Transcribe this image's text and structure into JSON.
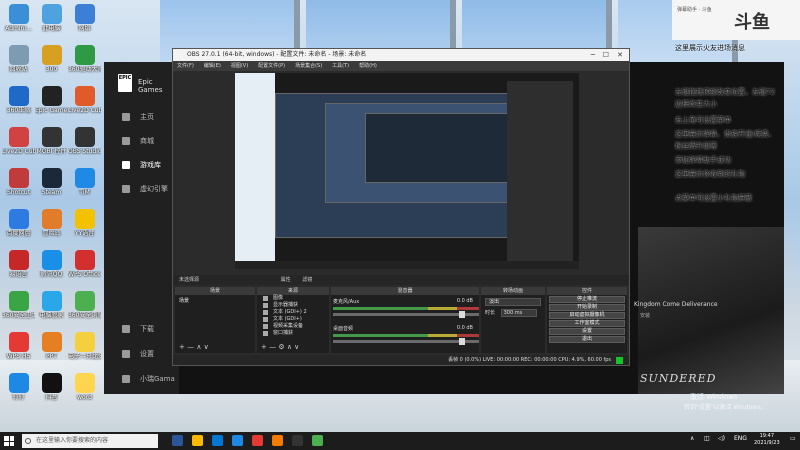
{
  "desktop_icons": [
    {
      "label": "Admini...",
      "color": "#3b8fd6"
    },
    {
      "label": "此电脑",
      "color": "#4ea2e0"
    },
    {
      "label": "网络",
      "color": "#3b7fd6"
    },
    {
      "label": "回收站",
      "color": "#7d9bb3"
    },
    {
      "label": "300",
      "color": "#d8a020"
    },
    {
      "label": "360驱动大师",
      "color": "#2e9b44"
    },
    {
      "label": "360压缩",
      "color": "#1d6bc7"
    },
    {
      "label": "Epic Games Launcher",
      "color": "#222222"
    },
    {
      "label": "Live2D Cubism",
      "color": "#e05a2a"
    },
    {
      "label": "Live2D Cubism",
      "color": "#d14343"
    },
    {
      "label": "MOBI 控件",
      "color": "#333333"
    },
    {
      "label": "OBS Studio",
      "color": "#333333"
    },
    {
      "label": "Shotcut",
      "color": "#c23b3b"
    },
    {
      "label": "Steam",
      "color": "#1b2838"
    },
    {
      "label": "TIM",
      "color": "#1e8ae6"
    },
    {
      "label": "百度网盘",
      "color": "#2d7be0"
    },
    {
      "label": "冒险岛",
      "color": "#e07c2a"
    },
    {
      "label": "YY语音",
      "color": "#f2c200"
    },
    {
      "label": "易语言",
      "color": "#c62828"
    },
    {
      "label": "腾讯QQ",
      "color": "#1a8fe8"
    },
    {
      "label": "WPS Office",
      "color": "#d32f2f"
    },
    {
      "label": "360安全卫士",
      "color": "#3aa545"
    },
    {
      "label": "电脑管家",
      "color": "#2aa7e8"
    },
    {
      "label": "360安全浏览器",
      "color": "#4caf50"
    },
    {
      "label": "WPS H5",
      "color": "#e53935"
    },
    {
      "label": "PPT",
      "color": "#e67e22"
    },
    {
      "label": "电子—只比资料",
      "color": "#f4d03f"
    },
    {
      "label": "钉钉",
      "color": "#1e88e5"
    },
    {
      "label": "抖音",
      "color": "#111111"
    },
    {
      "label": "word",
      "color": "#ffd54f"
    }
  ],
  "epic": {
    "brand": "Epic Games",
    "logo": "EPIC",
    "nav": [
      {
        "label": "主页",
        "icon": "home-icon"
      },
      {
        "label": "商城",
        "icon": "tag-icon"
      },
      {
        "label": "游戏库",
        "icon": "grid-icon",
        "active": true
      },
      {
        "label": "虚幻引擎",
        "icon": "unreal-icon"
      }
    ],
    "nav_bottom": [
      {
        "label": "下载",
        "icon": "download-icon"
      },
      {
        "label": "设置",
        "icon": "gear-icon"
      },
      {
        "label": "小瑞Gama",
        "icon": "user-icon"
      }
    ],
    "game_title": "Kingdom Come Deliverance",
    "game_sub": "安装",
    "game_logo": "SUNDERED"
  },
  "obs": {
    "title": "OBS 27.0.1 (64-bit, windows) - 配置文件: 未命名 - 场景: 未命名",
    "menu": [
      "文件(F)",
      "编辑(E)",
      "视图(V)",
      "配置文件(P)",
      "场景集合(S)",
      "工具(T)",
      "帮助(H)"
    ],
    "toolbar_label": "未选择源",
    "toolbar_props": "属性",
    "toolbar_filters": "滤镜",
    "dock_headers": [
      "场景",
      "来源",
      "混音器",
      "转场动画",
      "控件"
    ],
    "scenes": [
      "场景"
    ],
    "sources": [
      "图像",
      "显示器捕获",
      "文本 (GDI+) 2",
      "文本 (GDI+)",
      "视频采集设备",
      "窗口捕获"
    ],
    "mixer": [
      {
        "name": "麦克风/Aux",
        "level": "0.0 dB"
      },
      {
        "name": "桌面音频",
        "level": "0.0 dB"
      }
    ],
    "transition": {
      "type": "淡出",
      "duration_label": "时长",
      "duration": "300 ms"
    },
    "controls": [
      "停止推流",
      "开始录制",
      "启动虚拟摄像机",
      "工作室模式",
      "设置",
      "退出"
    ],
    "status": "丢帧 0 (0.0%)   LIVE: 00:00:00   REC: 00:00:00   CPU: 4.9%, 60.00 fps"
  },
  "douyu": {
    "logo": "斗鱼",
    "header": "弹幕助手 · 斗鱼",
    "lines": [
      "这里展示火友进场消息",
      "左键拖拽顶部改变位置，左键72",
      "边框改变大小",
      "右上角可设置菜单",
      "这里展示弹幕、贵族开通/续费、",
      "粉丝牌升级等",
      "添加弹幕助手成功",
      "这里展示你收到的礼物",
      "点菜单可设置小礼物屏蔽"
    ]
  },
  "watermark": {
    "line1": "激活 Windows",
    "line2": "转到\"设置\"以激活 Windows。"
  },
  "taskbar": {
    "search_placeholder": "在这里输入你要搜索的内容",
    "apps": [
      "#2b579a",
      "#ffb900",
      "#0078d4",
      "#1e88e5",
      "#e53935",
      "#f57c00",
      "#333333",
      "#4caf50"
    ],
    "lang": "ENG",
    "time": "19:47",
    "date": "2021/9/23"
  }
}
